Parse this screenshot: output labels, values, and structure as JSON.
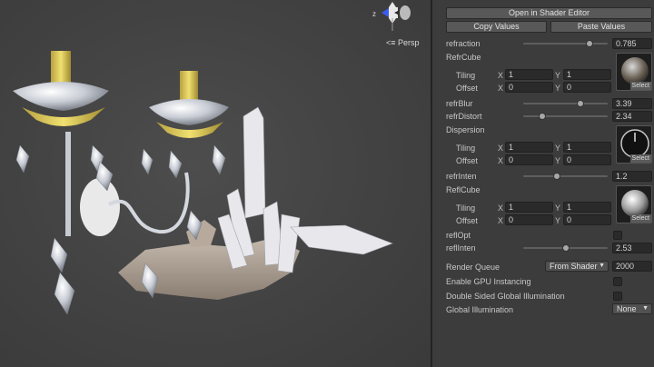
{
  "scene": {
    "view_mode": "Persp",
    "gizmo_axis": "z"
  },
  "inspector": {
    "open_editor": "Open in Shader Editor",
    "copy_values": "Copy Values",
    "paste_values": "Paste Values",
    "refraction": {
      "label": "refraction",
      "value": "0.785",
      "level": 0.785
    },
    "refr_cube": {
      "label": "RefrCube",
      "tiling_label": "Tiling",
      "offset_label": "Offset",
      "tiling_x": "1",
      "tiling_y": "1",
      "offset_x": "0",
      "offset_y": "0",
      "select": "Select"
    },
    "refr_blur": {
      "label": "refrBlur",
      "value": "3.39",
      "level": 0.68
    },
    "refr_distort": {
      "label": "refrDistort",
      "value": "2.34",
      "level": 0.23
    },
    "dispersion": {
      "label": "Dispersion",
      "tiling_label": "Tiling",
      "offset_label": "Offset",
      "tiling_x": "1",
      "tiling_y": "1",
      "offset_x": "0",
      "offset_y": "0",
      "select": "Select"
    },
    "refr_inten": {
      "label": "refrInten",
      "value": "1.2",
      "level": 0.4
    },
    "refl_cube": {
      "label": "ReflCube",
      "tiling_label": "Tiling",
      "offset_label": "Offset",
      "tiling_x": "1",
      "tiling_y": "1",
      "offset_x": "0",
      "offset_y": "0",
      "select": "Select"
    },
    "refl_opt": {
      "label": "reflOpt"
    },
    "refl_inten": {
      "label": "reflInten",
      "value": "2.53",
      "level": 0.5
    },
    "axis_x": "X",
    "axis_y": "Y",
    "render_queue": {
      "label": "Render Queue",
      "option": "From Shader",
      "value": "2000"
    },
    "gpu_instancing": {
      "label": "Enable GPU Instancing"
    },
    "double_sided_gi": {
      "label": "Double Sided Global Illumination"
    },
    "global_illumination": {
      "label": "Global Illumination",
      "option": "None"
    }
  }
}
